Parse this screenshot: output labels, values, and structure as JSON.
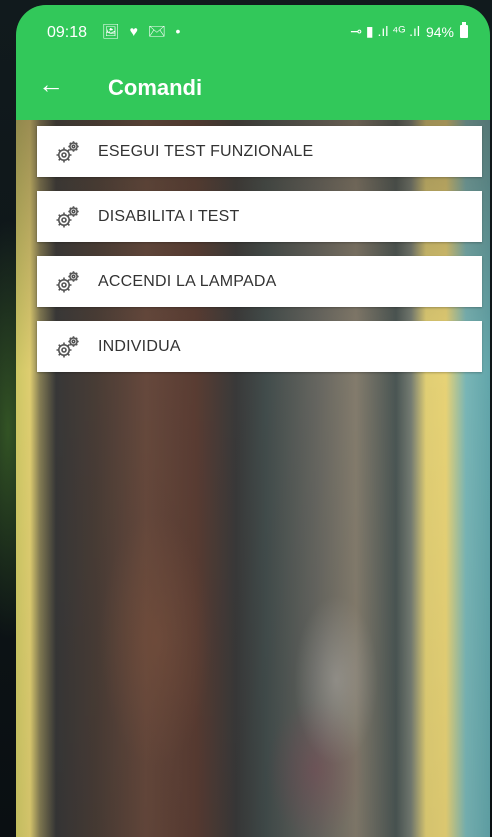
{
  "status_bar": {
    "time": "09:18",
    "left_icons": "🖼 ♥ ✉ •",
    "battery": "94%"
  },
  "app_bar": {
    "title": "Comandi",
    "back_icon": "arrow-left-icon"
  },
  "menu": {
    "items": [
      {
        "label": "ESEGUI TEST FUNZIONALE",
        "icon": "gears-icon"
      },
      {
        "label": "DISABILITA I TEST",
        "icon": "gears-icon"
      },
      {
        "label": "ACCENDI LA LAMPADA",
        "icon": "gears-icon"
      },
      {
        "label": "INDIVIDUA",
        "icon": "gears-icon"
      }
    ]
  },
  "colors": {
    "accent": "#32c85a"
  }
}
